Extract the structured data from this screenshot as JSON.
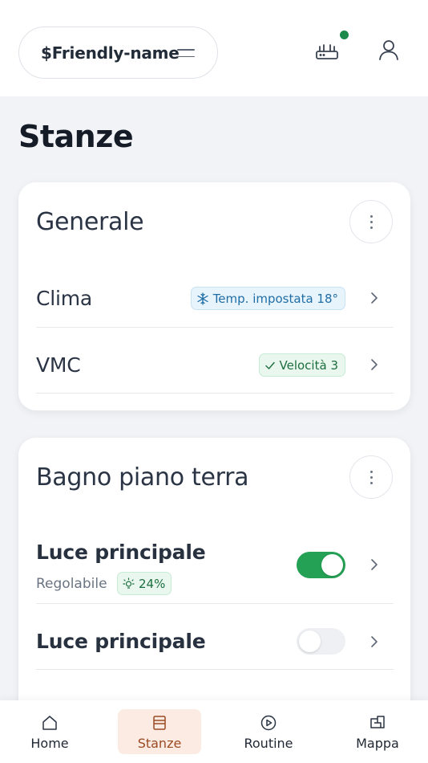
{
  "header": {
    "friendly_name": "$Friendly-name",
    "status_color": "#1b8a4a"
  },
  "page": {
    "title": "Stanze"
  },
  "rooms": [
    {
      "title": "Generale",
      "items": [
        {
          "label": "Clima",
          "badge": "Temp. impostata 18°",
          "badge_icon": "snowflake-icon",
          "badge_color": "#1f6ea6"
        },
        {
          "label": "VMC",
          "badge": "Velocità 3",
          "badge_icon": "check-icon",
          "badge_color": "#1d6e3f"
        }
      ]
    },
    {
      "title": "Bagno piano terra",
      "items": [
        {
          "label": "Luce principale",
          "sublabel": "Regolabile",
          "badge": "24%",
          "badge_icon": "bulb-icon",
          "toggle": "on"
        },
        {
          "label": "Luce principale",
          "toggle": "off"
        }
      ]
    }
  ],
  "nav": {
    "items": [
      {
        "label": "Home",
        "icon": "home-icon"
      },
      {
        "label": "Stanze",
        "icon": "rooms-icon",
        "active": true
      },
      {
        "label": "Routine",
        "icon": "play-icon"
      },
      {
        "label": "Mappa",
        "icon": "map-icon"
      }
    ],
    "active_color": "#9b4a22"
  },
  "colors": {
    "accent_green": "#24a155",
    "background": "#f2f3f6"
  }
}
